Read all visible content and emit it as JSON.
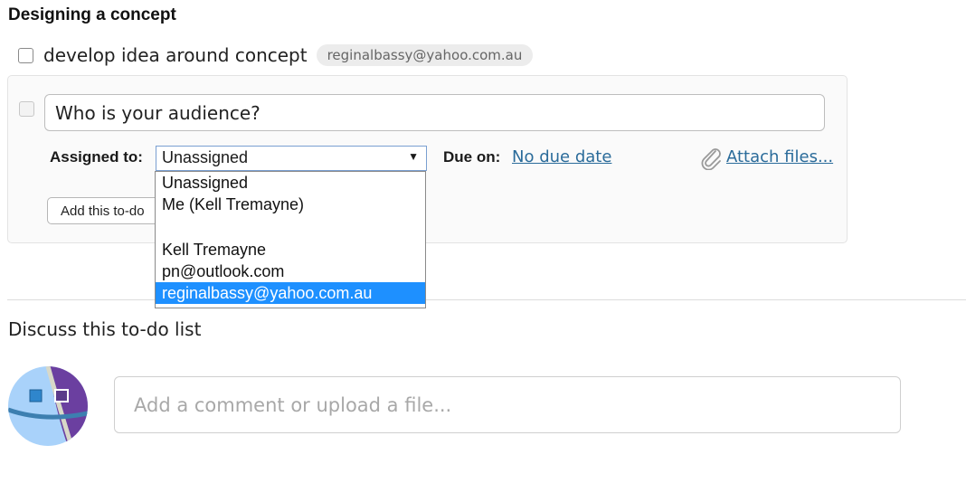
{
  "list": {
    "title": "Designing a concept"
  },
  "todo": {
    "text": "develop idea around concept",
    "assignee": "reginalbassy@yahoo.com.au"
  },
  "new_todo": {
    "input_value": "Who is your audience?",
    "assigned_label": "Assigned to:",
    "assigned_value": "Unassigned",
    "due_label": "Due on:",
    "due_value": "No due date",
    "attach_label": "Attach files...",
    "add_button_label": "Add this to-do"
  },
  "dropdown": {
    "options": [
      "Unassigned",
      "Me (Kell Tremayne)",
      "",
      "Kell Tremayne",
      "pn@outlook.com",
      "reginalbassy@yahoo.com.au"
    ],
    "selected_index": 5,
    "highlight_color": "#1e90ff"
  },
  "discussion": {
    "heading": "Discuss this to-do list",
    "comment_placeholder": "Add a comment or upload a file..."
  },
  "colors": {
    "link": "#2a6b9a",
    "avatar_light": "#9ecbf7",
    "avatar_purple": "#6b3fa0"
  },
  "icons": {
    "attach": "paperclip-icon",
    "dropdown": "triangle-down-icon"
  }
}
